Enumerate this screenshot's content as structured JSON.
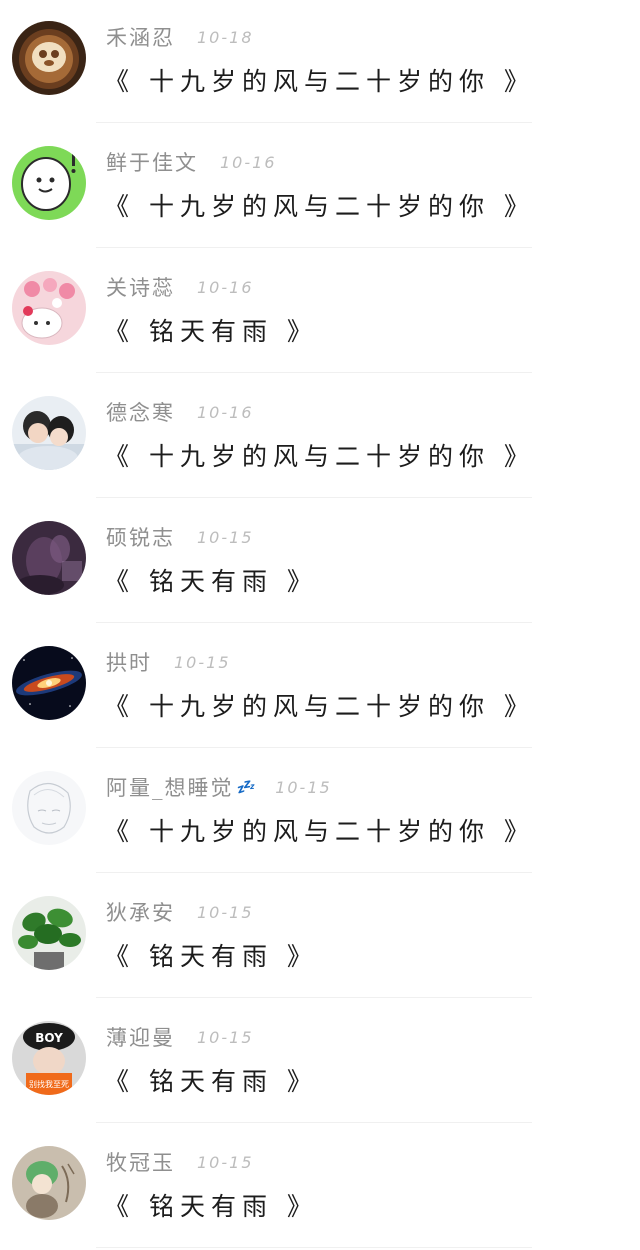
{
  "comments": [
    {
      "name": "禾涵忍",
      "date": "10-18",
      "title": "《 十九岁的风与二十岁的你 》",
      "avatar_icon": "latte-art-avatar"
    },
    {
      "name": "鲜于佳文",
      "date": "10-16",
      "title": "《 十九岁的风与二十岁的你 》",
      "avatar_icon": "green-cartoon-avatar"
    },
    {
      "name": "关诗蕊",
      "date": "10-16",
      "title": "《 铭天有雨 》",
      "avatar_icon": "hello-kitty-case-avatar"
    },
    {
      "name": "德念寒",
      "date": "10-16",
      "title": "《 十九岁的风与二十岁的你 》",
      "avatar_icon": "couple-photo-avatar"
    },
    {
      "name": "硕锐志",
      "date": "10-15",
      "title": "《 铭天有雨 》",
      "avatar_icon": "purple-portrait-avatar"
    },
    {
      "name": "拱时",
      "date": "10-15",
      "title": "《 十九岁的风与二十岁的你 》",
      "avatar_icon": "galaxy-avatar"
    },
    {
      "name": "阿量_想睡觉",
      "name_emoji": "💤",
      "date": "10-15",
      "title": "《 十九岁的风与二十岁的你 》",
      "avatar_icon": "sketch-portrait-avatar"
    },
    {
      "name": "狄承安",
      "date": "10-15",
      "title": "《 铭天有雨 》",
      "avatar_icon": "plant-avatar"
    },
    {
      "name": "薄迎曼",
      "date": "10-15",
      "title": "《 铭天有雨 》",
      "avatar_icon": "boy-cap-avatar",
      "avatar_text": "BOY",
      "avatar_caption": "别找我至死"
    },
    {
      "name": "牧冠玉",
      "date": "10-15",
      "title": "《 铭天有雨 》",
      "avatar_icon": "anime-girl-avatar"
    }
  ],
  "colors": {
    "name": "#8f8f8f",
    "date": "#bdbdbd",
    "title": "#1c1c1c",
    "divider": "#f0f0f0",
    "emoji": "#2c6fd6"
  }
}
